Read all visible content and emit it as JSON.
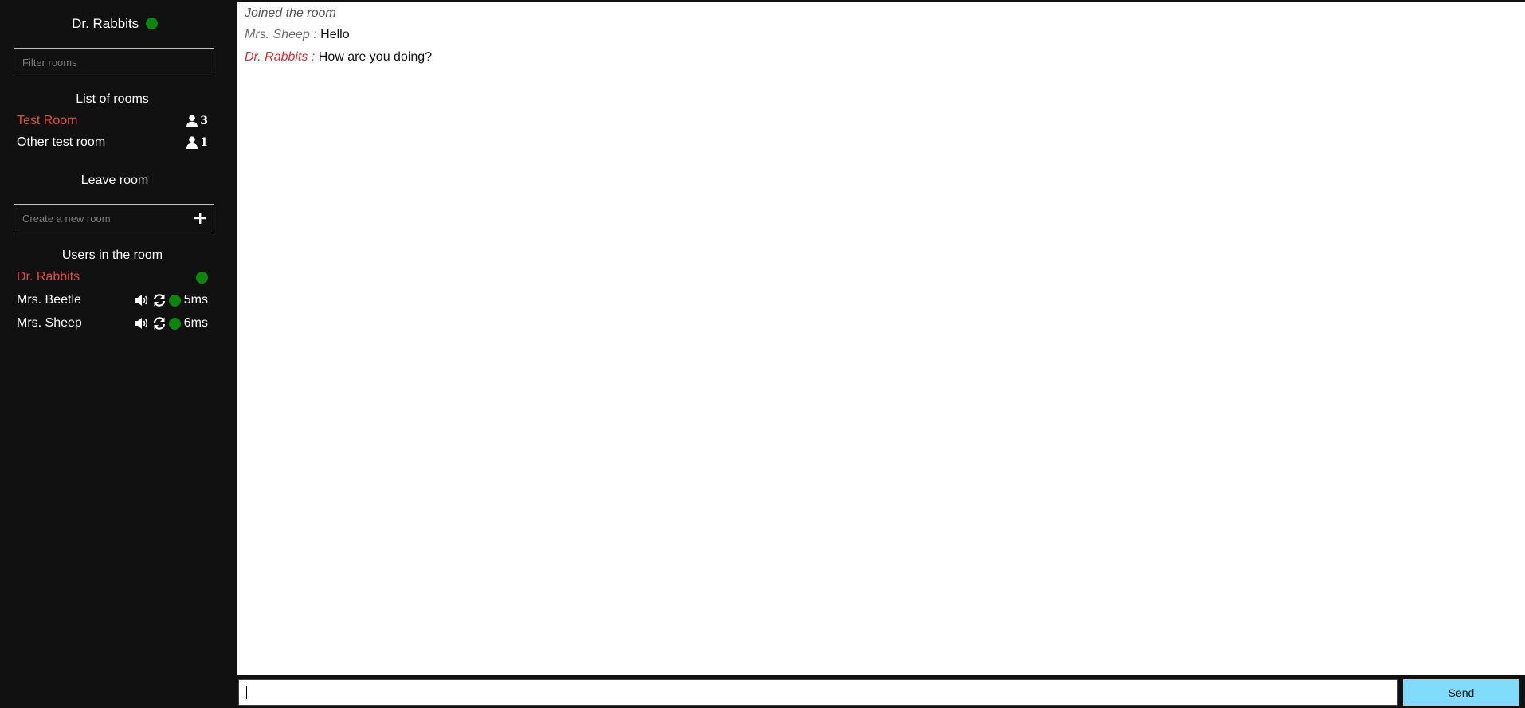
{
  "current_user": {
    "name": "Dr. Rabbits",
    "status": "online",
    "status_color": "#0c860c"
  },
  "filter": {
    "placeholder": "Filter rooms",
    "value": ""
  },
  "rooms": {
    "title": "List of rooms",
    "items": [
      {
        "name": "Test Room",
        "count": "3",
        "active": true
      },
      {
        "name": "Other test room",
        "count": "1",
        "active": false
      }
    ]
  },
  "leave_room_label": "Leave room",
  "create_room": {
    "placeholder": "Create a new room",
    "value": "",
    "add_icon": "plus-icon"
  },
  "users": {
    "title": "Users in the room",
    "items": [
      {
        "name": "Dr. Rabbits",
        "self": true,
        "status": "online",
        "ping": ""
      },
      {
        "name": "Mrs. Beetle",
        "self": false,
        "status": "online",
        "ping": "5ms",
        "icons": [
          "volume-icon",
          "refresh-icon"
        ]
      },
      {
        "name": "Mrs. Sheep",
        "self": false,
        "status": "online",
        "ping": "6ms",
        "icons": [
          "volume-icon",
          "refresh-icon"
        ]
      }
    ]
  },
  "chat": {
    "messages": [
      {
        "type": "system",
        "text": "Joined the room"
      },
      {
        "type": "message",
        "author": "Mrs. Sheep",
        "separator": " : ",
        "text": "Hello",
        "mine": false
      },
      {
        "type": "message",
        "author": "Dr. Rabbits",
        "separator": " : ",
        "text": "How are you doing?",
        "mine": true
      }
    ]
  },
  "composer": {
    "value": "",
    "placeholder": "",
    "send_label": "Send"
  },
  "colors": {
    "accent_red": "#e84848",
    "send_button": "#7fdcfa",
    "online_green": "#0c860c",
    "sidebar_bg": "#111111"
  }
}
